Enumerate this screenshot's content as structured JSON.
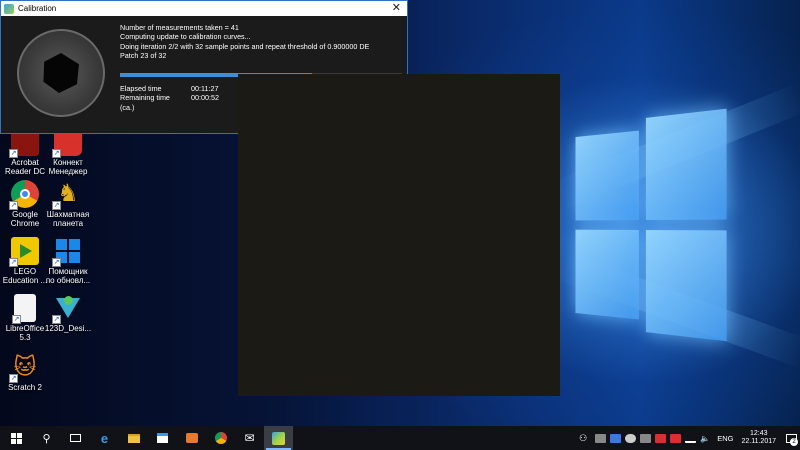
{
  "calibration_window": {
    "title": "Calibration",
    "close_glyph": "✕",
    "status_lines": [
      "Number of measurements taken = 41",
      "Computing update to calibration curves...",
      "Doing iteration 2/2 with 32 sample points and repeat threshold of 0.900000 DE",
      "Patch 23 of 32"
    ],
    "progress_fraction": 0.68,
    "elapsed_label": "Elapsed time",
    "elapsed_value": "00:11:27",
    "remaining_label": "Remaining time (ca.)",
    "remaining_value": "00:00:52"
  },
  "desktop_icons": [
    {
      "name": "acrobat",
      "label_line1": "Acrobat",
      "label_line2": "Reader DC",
      "color": "#c8201a"
    },
    {
      "name": "konnekt",
      "label_line1": "Коннект",
      "label_line2": "Менеджер",
      "color": "#d8302a"
    },
    {
      "name": "chrome",
      "label_line1": "Google",
      "label_line2": "Chrome",
      "color": "#e8b020"
    },
    {
      "name": "chess",
      "label_line1": "Шахматная",
      "label_line2": "планета",
      "color": "#d8a020"
    },
    {
      "name": "lego",
      "label_line1": "LEGO",
      "label_line2": "Education ...",
      "color": "#f0c800"
    },
    {
      "name": "windows-update",
      "label_line1": "Помощник",
      "label_line2": "по обновл...",
      "color": "#1a78d8"
    },
    {
      "name": "libreoffice",
      "label_line1": "LibreOffice",
      "label_line2": "5.3",
      "color": "#e8e8e8"
    },
    {
      "name": "123d",
      "label_line1": "123D_Desi...",
      "label_line2": "",
      "color": "#30a8c8"
    },
    {
      "name": "scratch",
      "label_line1": "Scratch 2",
      "label_line2": "",
      "color": "#f08a20"
    }
  ],
  "taskbar": {
    "apps": [
      "windows-logo-icon",
      "search-icon",
      "task-view-icon",
      "edge-icon",
      "file-explorer-icon",
      "store-icon",
      "media-player-icon",
      "chrome-icon",
      "mail-icon",
      "calibration-app-icon"
    ],
    "language": "ENG",
    "time": "12:43",
    "date": "22.11.2017",
    "notification_count": "2"
  }
}
